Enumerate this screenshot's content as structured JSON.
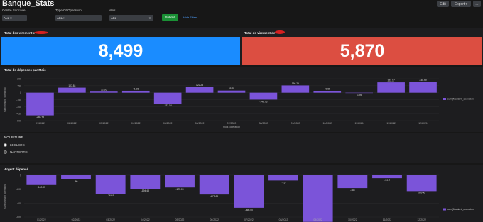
{
  "app": {
    "title": "Banque_Stats"
  },
  "header": {
    "edit": "Edit",
    "export": "Export ▾",
    "more": "..."
  },
  "filters": {
    "centre_label": "Centre Bancaire",
    "centre_value": "ALL ×",
    "type_label": "Type Of Operation",
    "type_value": "ALL ×",
    "mois_label": "Mois",
    "mois_value": "ALL",
    "submit": "Submit",
    "hide": "Hide Filters"
  },
  "kpis": [
    {
      "title": "Total des virement e",
      "value": "8,499",
      "color": "#1a8cff"
    },
    {
      "title": "Total de virement de",
      "value": "5,870",
      "color": "#dc4e41"
    }
  ],
  "chart_data": [
    {
      "type": "bar",
      "title": "Total de dépenses par Mois",
      "xlabel": "mois_operation",
      "ylabel": "sum(Montant_operation)",
      "ylim": [
        -600,
        300
      ],
      "yticks": [
        "300",
        "150",
        "0",
        "-150",
        "-300",
        "-450",
        "-600"
      ],
      "categories": [
        "01/2022",
        "02/2022",
        "03/2022",
        "04/2022",
        "05/2022",
        "06/2022",
        "07/2022",
        "08/2022",
        "09/2022",
        "10/2022",
        "11/2021",
        "11/2022",
        "12/2021"
      ],
      "values": [
        -486.78,
        107.84,
        22.65,
        41.23,
        -237.14,
        122.28,
        45.35,
        -148.73,
        156.29,
        40.66,
        -1.95,
        222.17,
        230.99
      ],
      "labels": [
        "-486.78",
        "107.84",
        "22.65",
        "41.23",
        "-237.14",
        "122.28",
        "45.35",
        "-148.73",
        "156.29",
        "40.66",
        "-1.95",
        "222.17",
        "230.99"
      ],
      "legend": "sum(Montant_operation)",
      "color": "#7b54d9"
    },
    {
      "type": "bar",
      "title": "Argent dépensé",
      "xlabel": "",
      "ylabel": "sum(Montant_operation)",
      "ylim": [
        -600,
        0
      ],
      "yticks": [
        "0",
        "-200",
        "-400",
        "-600"
      ],
      "categories": [
        "01/2022",
        "02/2022",
        "03/2022",
        "04/2022",
        "05/2022",
        "06/2022",
        "07/2022",
        "08/2022",
        "09/2022",
        "10/2022",
        "11/2022",
        "12/2022"
      ],
      "values": [
        -140.05,
        -60,
        -264.9,
        -194.48,
        -175.09,
        -275.89,
        -466.5,
        -75,
        -668.9,
        -184,
        -41.9,
        -227.51
      ],
      "labels": [
        "-140.05",
        "-60",
        "-264.9",
        "-194.48",
        "-175.09",
        "-275.89",
        "-466.50",
        "-75",
        "-668.9",
        "-184",
        "-41.9",
        "-227.51"
      ],
      "legend": "sum(Montant_operation)",
      "color": "#7b54d9"
    }
  ],
  "radio": {
    "title": "NOURITURE",
    "options": [
      "LECLERC",
      "NANTERRE"
    ]
  }
}
